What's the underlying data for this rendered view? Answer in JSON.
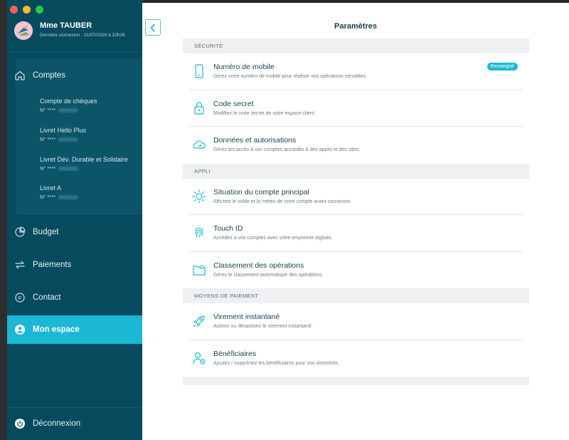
{
  "window": {
    "accent": "#1db7d6",
    "sidebar_bg": "#064a5e"
  },
  "profile": {
    "name": "Mme TAUBER",
    "last_login": "Dernière connexion : 21/07/2020 à 10h26"
  },
  "sidebar": {
    "comptes_label": "Comptes",
    "accounts": [
      {
        "name": "Compte de chèques",
        "number": "N° **** "
      },
      {
        "name": "Livret Hello Plus",
        "number": "N° **** "
      },
      {
        "name": "Livret Dév. Durable et Solidaire",
        "number": "N° **** "
      },
      {
        "name": "Livret A",
        "number": "N° **** "
      }
    ],
    "items": [
      {
        "label": "Budget",
        "icon": "pie-chart-icon"
      },
      {
        "label": "Paiements",
        "icon": "transfer-arrows-icon"
      },
      {
        "label": "Contact",
        "icon": "chat-bubble-icon"
      },
      {
        "label": "Mon espace",
        "icon": "user-icon",
        "active": true
      }
    ],
    "logout_label": "Déconnexion"
  },
  "main": {
    "title": "Paramètres",
    "sections": [
      {
        "header": "SÉCURITÉ",
        "items": [
          {
            "title": "Numéro de mobile",
            "desc": "Gérez votre numéro de mobile pour réaliser vos opérations sensibles.",
            "badge": "Renseigné",
            "icon": "mobile-phone-icon"
          },
          {
            "title": "Code secret",
            "desc": "Modifiez le code secret de votre espace client.",
            "icon": "lock-icon"
          },
          {
            "title": "Données et autorisations",
            "desc": "Gérez les accès à vos comptes accordés à des applis et des sites.",
            "icon": "cloud-arrow-icon"
          }
        ]
      },
      {
        "header": "APPLI",
        "items": [
          {
            "title": "Situation du compte principal",
            "desc": "Affichez le solde et la météo de votre compte avant connexion.",
            "icon": "sun-icon"
          },
          {
            "title": "Touch ID",
            "desc": "Accédez à vos comptes avec votre empreinte digitale.",
            "icon": "fingerprint-icon"
          },
          {
            "title": "Classement des opérations",
            "desc": "Gérez le classement automatique des opérations.",
            "icon": "folder-tag-icon"
          }
        ]
      },
      {
        "header": "MOYENS DE PAIEMENT",
        "items": [
          {
            "title": "Virement instantané",
            "desc": "Activez ou désactivez le virement instantané.",
            "icon": "rocket-icon"
          },
          {
            "title": "Bénéficiaires",
            "desc": "Ajoutez / supprimez les bénéficiaires pour vos virements.",
            "icon": "beneficiary-icon"
          }
        ]
      }
    ]
  }
}
